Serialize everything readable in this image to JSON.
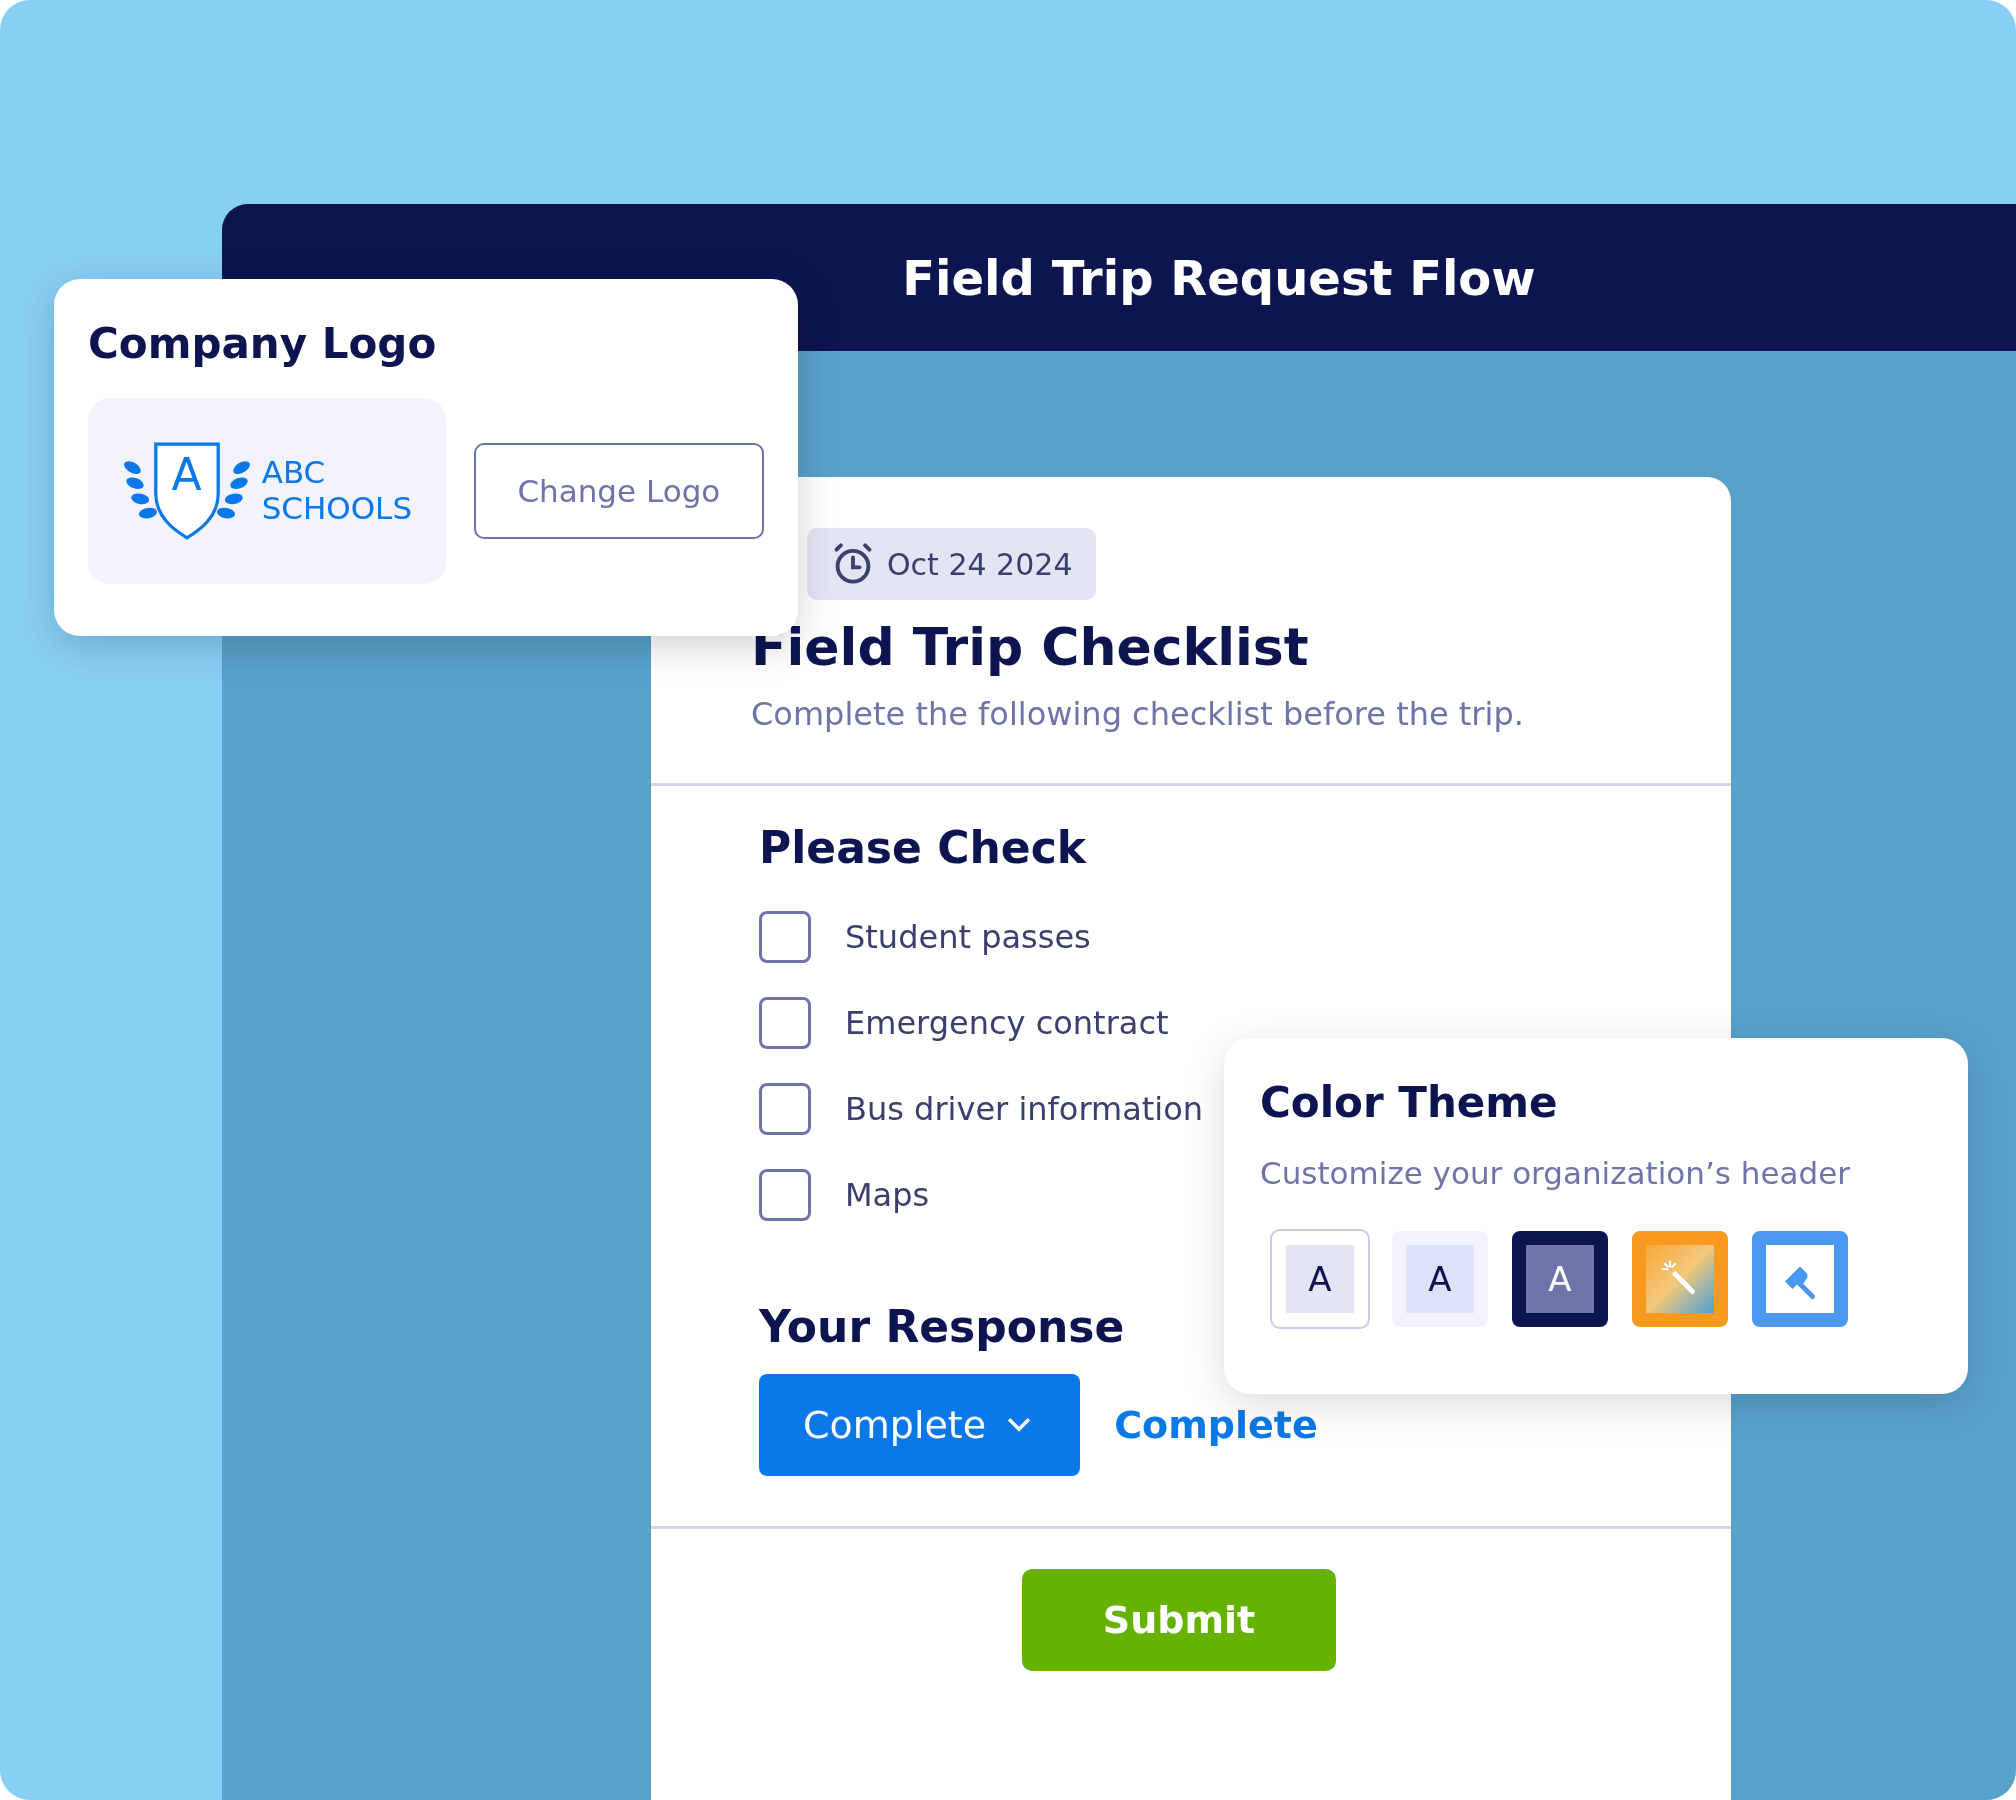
{
  "header": {
    "title": "Field Trip Request Flow"
  },
  "logo_card": {
    "title": "Company Logo",
    "logo": {
      "letter": "A",
      "lines": [
        "ABC",
        "SCHOOLS"
      ]
    },
    "button": "Change Logo"
  },
  "form": {
    "date": "Oct 24 2024",
    "title": "Field Trip Checklist",
    "subtitle": "Complete the following checklist before the trip.",
    "check_heading": "Please Check",
    "items": [
      {
        "label": "Student passes",
        "checked": false
      },
      {
        "label": "Emergency contract",
        "checked": false
      },
      {
        "label": "Bus driver information",
        "checked": false
      },
      {
        "label": "Maps",
        "checked": false
      }
    ],
    "response_heading": "Your Response",
    "dropdown": "Complete",
    "response_link": "Complete",
    "submit": "Submit"
  },
  "theme_card": {
    "title": "Color Theme",
    "subtitle": "Customize your organization’s header",
    "swatches": [
      {
        "kind": "outlined",
        "label": "A"
      },
      {
        "kind": "pale",
        "label": "A"
      },
      {
        "kind": "dark",
        "label": "A"
      },
      {
        "kind": "gradient"
      },
      {
        "kind": "roller"
      }
    ]
  }
}
